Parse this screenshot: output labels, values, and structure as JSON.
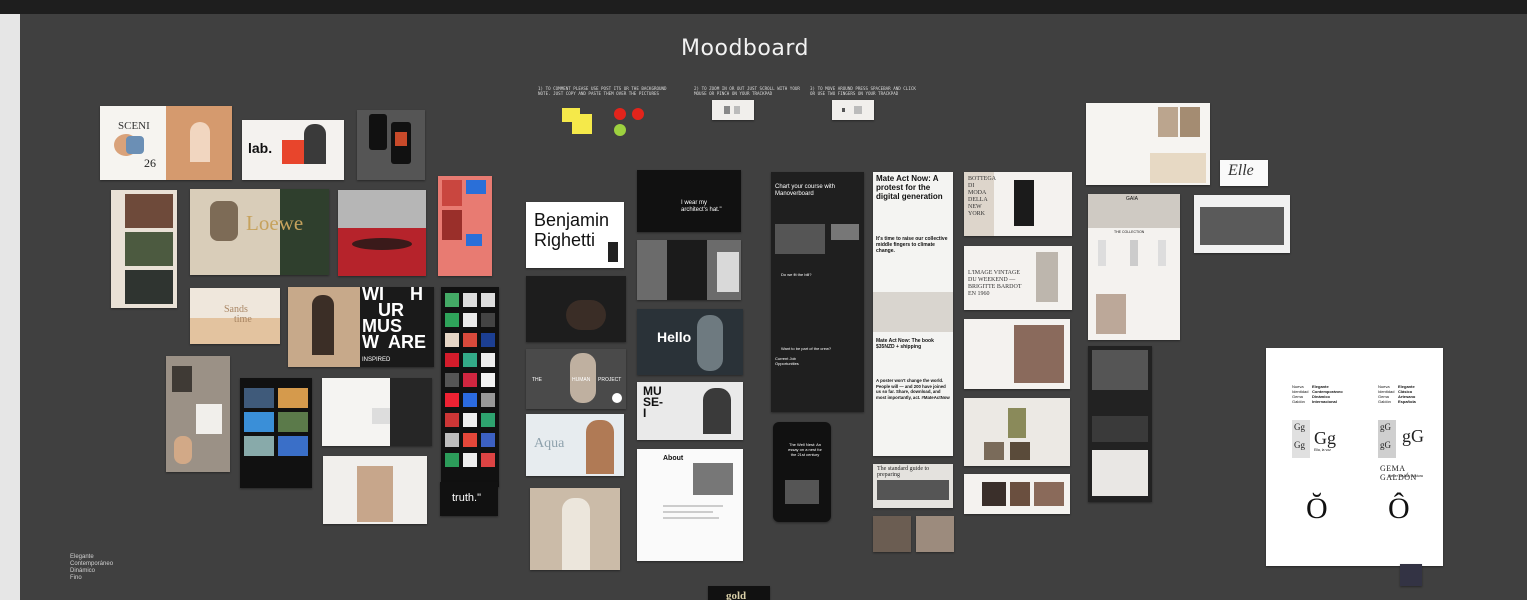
{
  "board": {
    "title": "Moodboard",
    "instructions": [
      "1) To comment please use post its or the background note. Just copy and paste them over the pictures",
      "2) To zoom in or out just scroll with your mouse or pinch on your trackpad",
      "3) To move around press spacebar and click or use two fingers on your trackpad"
    ],
    "keywords": [
      "Elegante",
      "Contemporáneo",
      "Dinámico",
      "Fino"
    ]
  },
  "cards": {
    "sceni": {
      "title": "SCENI",
      "num": "26"
    },
    "lab": {
      "title": "lab."
    },
    "loewe": {
      "title": "Loewe"
    },
    "sands": {
      "title": "Sands",
      "subtitle": "time"
    },
    "wiurmus": {
      "lines": [
        "WI",
        "H",
        "UR",
        "MUS",
        "W",
        "ARE"
      ],
      "footer": "INSPIRED"
    },
    "truth": {
      "text": "truth.\""
    },
    "benjamin": {
      "title": "Benjamin Righetti"
    },
    "hat": {
      "text": "I wear my architect's hat.\""
    },
    "hello": {
      "text": "Hello"
    },
    "human": {
      "left": "THE",
      "mid": "HUMAN",
      "right": "PROJECT"
    },
    "aqua": {
      "title": "Aqua"
    },
    "about": {
      "title": "About"
    },
    "muse": {
      "text": "MUSE-I"
    },
    "gold": {
      "text": "gold"
    },
    "manoverboard": {
      "headline": "Chart your course with Manoverboard",
      "q1": "Do we fit the bill?",
      "q2": "Want to be part of the crew?",
      "q3": "Current Job Opportunities"
    },
    "mateact": {
      "headline": "Mate Act Now: A protest for the digital generation",
      "body": "It's time to raise our collective middle fingers to climate change.",
      "book": "Mate Act Now: The book $35NZD + shipping",
      "quote": "A poster won't change the world. People will — and 200 have joined us so far. Share, download, and most importantly, act. #MateActNow"
    },
    "phone": {
      "text": "The Well Nest: An essay on a nest for the 21st century"
    },
    "bottega": {
      "text": "BOTTEGA DI MODA DELLA NEW YORK"
    },
    "vintage": {
      "text": "L'IMAGE VINTAGE DU WEEKEND — BRIGITTE BARDOT EN 1960"
    },
    "gaia": {
      "title": "GAIA"
    },
    "collection": {
      "title": "THE COLLECTION"
    },
    "cardPost": {
      "text": "The standard guide to preparing"
    },
    "scriptHand": {
      "text": "Elle"
    },
    "typeSpecimen": {
      "left": {
        "label1": "Nueva",
        "label2": "Identidad",
        "label3": "Gema",
        "label4": "Galdón",
        "val1": "Elegante",
        "val2": "Contemporáneo",
        "val3": "Dinámico",
        "val4": "Internacional"
      },
      "right": {
        "label1": "Nueva",
        "label2": "Identidad",
        "label3": "Gema",
        "label4": "Galdón",
        "val1": "Elegante",
        "val2": "Clásico",
        "val3": "Artesano",
        "val4": "Española"
      },
      "gg1": "Gg",
      "gg2": "Gg",
      "gg3": "Gg",
      "gg4": "gG",
      "gg5": "gG",
      "gg6": "gG",
      "name": "GEMA GALDÓN",
      "sub1": "Ella, la voz",
      "sub2": "Atelier de Alta Costura",
      "glyph1": "Ŏ",
      "glyph2": "Ô"
    }
  },
  "colors": {
    "canvas": "#404040",
    "sticky": "#f5e94a",
    "red": "#e3241b",
    "green": "#9dd13f"
  }
}
